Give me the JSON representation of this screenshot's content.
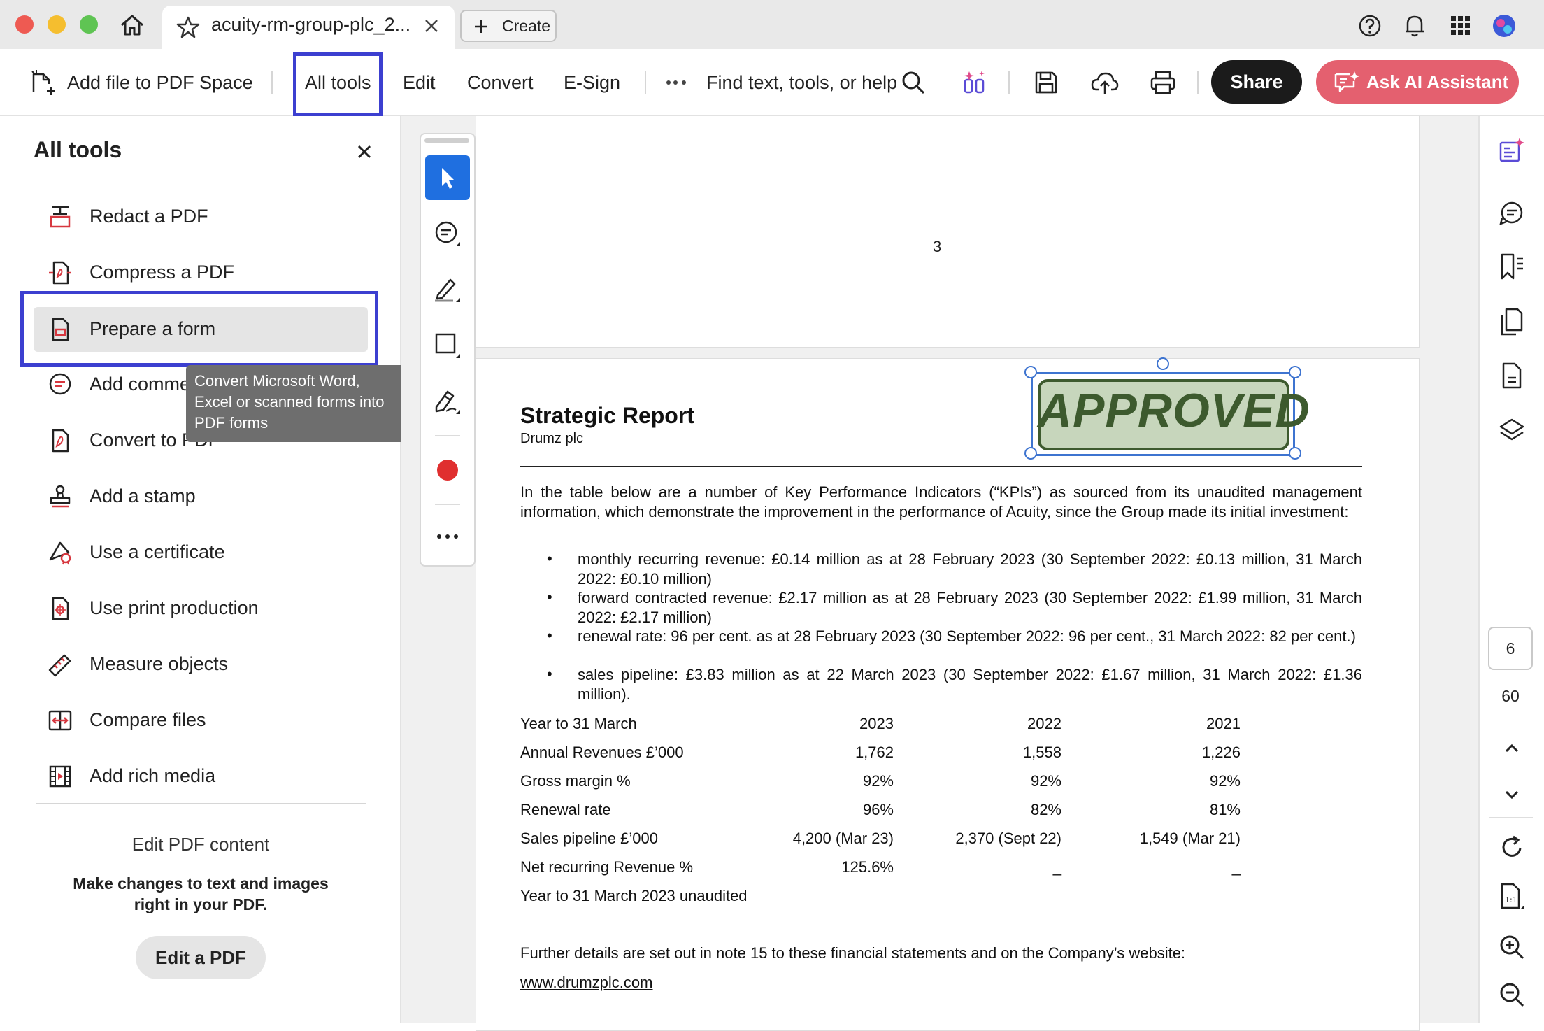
{
  "browser": {
    "tab_title": "acuity-rm-group-plc_2...",
    "create_label": "Create"
  },
  "toolbar": {
    "add_file": "Add file to PDF Space",
    "all_tools": "All tools",
    "edit": "Edit",
    "convert": "Convert",
    "esign": "E-Sign",
    "search": "Find text, tools, or help",
    "share": "Share",
    "ai_assistant": "Ask AI Assistant"
  },
  "panel": {
    "title": "All tools",
    "items": [
      {
        "label": "Redact a PDF",
        "icon": "redact-icon"
      },
      {
        "label": "Compress a PDF",
        "icon": "compress-icon"
      },
      {
        "label": "Prepare a form",
        "icon": "form-icon"
      },
      {
        "label": "Add comments",
        "icon": "comment-icon"
      },
      {
        "label": "Convert to PDF",
        "icon": "convert-pdf-icon"
      },
      {
        "label": "Add a stamp",
        "icon": "stamp-icon"
      },
      {
        "label": "Use a certificate",
        "icon": "certificate-icon"
      },
      {
        "label": "Use print production",
        "icon": "print-production-icon"
      },
      {
        "label": "Measure objects",
        "icon": "ruler-icon"
      },
      {
        "label": "Compare files",
        "icon": "compare-icon"
      },
      {
        "label": "Add rich media",
        "icon": "film-icon"
      }
    ],
    "tooltip": "Convert Microsoft Word, Excel or scanned forms into PDF forms",
    "edit_title": "Edit PDF content",
    "edit_desc": "Make changes to text and images right in your PDF.",
    "edit_button": "Edit a PDF"
  },
  "document": {
    "page_number": "3",
    "stamp": "APPROVED",
    "title": "Strategic Report",
    "subtitle": "Drumz plc",
    "intro": "In the table below are a number of Key Performance Indicators (“KPIs”) as sourced from its unaudited management information, which demonstrate the improvement in the performance of Acuity, since the Group made its initial investment:",
    "bullets": [
      "monthly recurring revenue: £0.14 million as at 28 February 2023 (30 September 2022: £0.13 million, 31 March 2022: £0.10 million)",
      "forward contracted revenue: £2.17 million as at 28 February 2023 (30 September 2022: £1.99 million, 31 March 2022: £2.17 million)",
      "renewal rate: 96 per cent. as at 28 February 2023 (30 September 2022: 96 per cent., 31 March 2022: 82 per cent.)",
      "sales pipeline: £3.83 million as at 22 March 2023 (30 September 2022: £1.67 million, 31 March 2022: £1.36 million)."
    ],
    "table": [
      [
        "Year to 31 March",
        "2023",
        "2022",
        "2021"
      ],
      [
        "Annual Revenues £’000",
        "1,762",
        "1,558",
        "1,226"
      ],
      [
        "Gross margin %",
        "92%",
        "92%",
        "92%"
      ],
      [
        "Renewal rate",
        "96%",
        "82%",
        "81%"
      ],
      [
        "Sales pipeline £’000",
        "4,200 (Mar 23)",
        "2,370 (Sept 22)",
        "1,549 (Mar 21)"
      ],
      [
        "Net recurring Revenue %",
        "125.6%",
        "_",
        "_"
      ]
    ],
    "table_note": "Year to 31 March 2023 unaudited",
    "further": "Further details are set out in note 15 to these financial statements and on the Company’s website:",
    "website": "www.drumzplc.com"
  },
  "nav": {
    "page_current": "6",
    "page_total": "60"
  },
  "colors": {
    "accent_blue": "#1f6fe0",
    "highlight": "#3c3fd0",
    "ai_button": "#e4606f",
    "stamp_green": "#3d5a2e"
  }
}
